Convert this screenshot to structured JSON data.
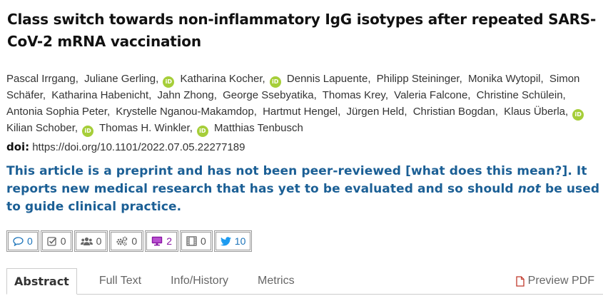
{
  "article": {
    "title": "Class switch towards non-inflammatory IgG isotypes after repeated SARS-CoV-2 mRNA vaccination",
    "doi_label": "doi:",
    "doi": "https://doi.org/10.1101/2022.07.05.22277189"
  },
  "authors": [
    {
      "name": "Pascal Irrgang",
      "orcid": false
    },
    {
      "name": "Juliane Gerling",
      "orcid": true
    },
    {
      "name": "Katharina Kocher",
      "orcid": true
    },
    {
      "name": "Dennis Lapuente",
      "orcid": false
    },
    {
      "name": "Philipp Steininger",
      "orcid": false
    },
    {
      "name": "Monika Wytopil",
      "orcid": false
    },
    {
      "name": "Simon Schäfer",
      "orcid": false
    },
    {
      "name": "Katharina Habenicht",
      "orcid": false
    },
    {
      "name": "Jahn Zhong",
      "orcid": false
    },
    {
      "name": "George Ssebyatika",
      "orcid": false
    },
    {
      "name": "Thomas Krey",
      "orcid": false
    },
    {
      "name": "Valeria Falcone",
      "orcid": false
    },
    {
      "name": "Christine Schülein",
      "orcid": false
    },
    {
      "name": "Antonia Sophia Peter",
      "orcid": false
    },
    {
      "name": "Krystelle Nganou-Makamdop",
      "orcid": false
    },
    {
      "name": "Hartmut Hengel",
      "orcid": false
    },
    {
      "name": "Jürgen Held",
      "orcid": false
    },
    {
      "name": "Christian Bogdan",
      "orcid": false
    },
    {
      "name": "Klaus Überla",
      "orcid": true
    },
    {
      "name": "Kilian Schober",
      "orcid": true
    },
    {
      "name": "Thomas H. Winkler",
      "orcid": true
    },
    {
      "name": "Matthias Tenbusch",
      "orcid": false
    }
  ],
  "orcid_icon_text": "iD",
  "notice": {
    "part1": "This article is a preprint and has not been peer-reviewed ",
    "link": "[what does this mean?]",
    "part2": ". It reports new medical research that has yet to be evaluated and so should ",
    "emphasis": "not",
    "part3": " be used to guide clinical practice."
  },
  "metrics": [
    {
      "icon": "comment-icon",
      "value": "0"
    },
    {
      "icon": "check-square-icon",
      "value": "0"
    },
    {
      "icon": "users-icon",
      "value": "0"
    },
    {
      "icon": "gears-icon",
      "value": "0"
    },
    {
      "icon": "monitor-icon",
      "value": "2"
    },
    {
      "icon": "film-icon",
      "value": "0"
    },
    {
      "icon": "twitter-icon",
      "value": "10"
    }
  ],
  "tabs": [
    {
      "label": "Abstract",
      "active": true
    },
    {
      "label": "Full Text",
      "active": false
    },
    {
      "label": "Info/History",
      "active": false
    },
    {
      "label": "Metrics",
      "active": false
    }
  ],
  "preview_pdf_label": "Preview PDF",
  "colors": {
    "notice": "#1b5f95",
    "orcid": "#a6ce39",
    "twitter": "#1b73b9",
    "altmetric_purple": "#8a17a5",
    "pdf_red": "#c0392b"
  }
}
